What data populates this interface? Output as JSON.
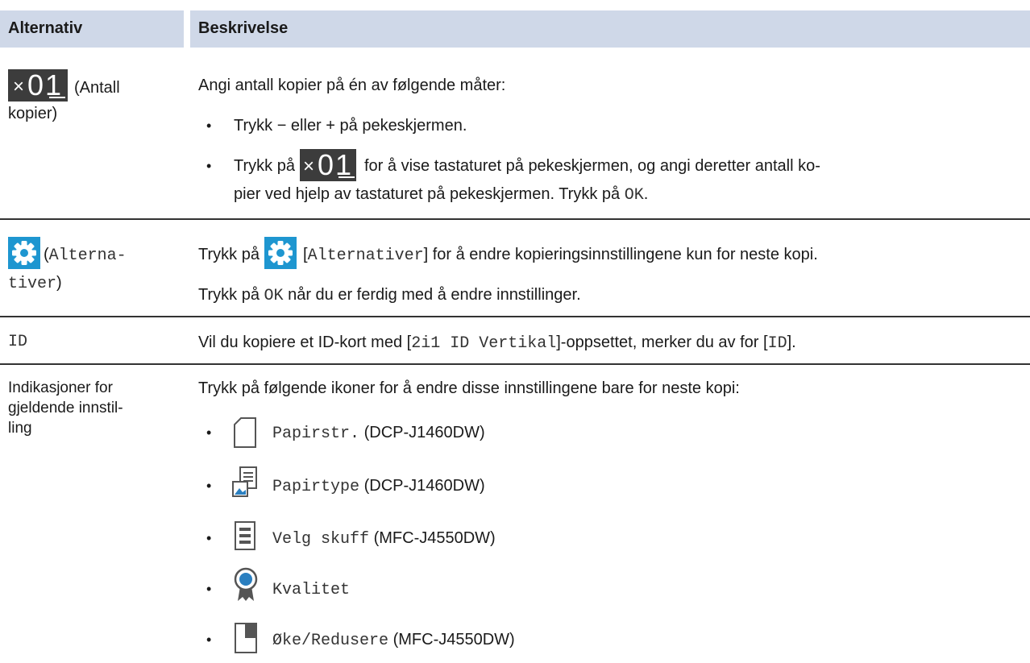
{
  "header": {
    "col1": "Alternativ",
    "col2": "Beskrivelse"
  },
  "row1": {
    "icon_x": "×",
    "icon_num": "01",
    "name1": "(Antall",
    "name2": "kopier)",
    "intro": "Angi antall kopier på én av følgende måter:",
    "b1": "Trykk − eller + på pekeskjermen.",
    "b2_pre": "Trykk på",
    "b2_post": "for å vise tastaturet på pekeskjermen, og angi deretter antall ko-",
    "b2_line2_pre": "pier ved hjelp av tastaturet på pekeskjermen. Trykk på",
    "b2_ok": "OK",
    "b2_end": "."
  },
  "row2": {
    "name1_paren": "(",
    "name1": "Alterna-",
    "name2": "tiver",
    "name2_paren": ")",
    "l1_pre": "Trykk på",
    "l1_bracket_open": "[",
    "l1_mono": "Alternativer",
    "l1_post": "] for å endre kopieringsinnstillingene kun for neste kopi.",
    "l2_pre": "Trykk på",
    "l2_ok": "OK",
    "l2_post": "når du er ferdig med å endre innstillinger."
  },
  "row3": {
    "name": "ID",
    "pre": "Vil du kopiere et ID-kort med [",
    "mono1": "2i1 ID Vertikal",
    "mid": "]-oppsettet, merker du av for [",
    "mono2": "ID",
    "end": "]."
  },
  "row4": {
    "name1": "Indikasjoner for",
    "name2": "gjeldende innstil-",
    "name3": "ling",
    "intro": "Trykk på følgende ikoner for å endre disse innstillingene bare for neste kopi:",
    "items": [
      {
        "mono": "Papirstr.",
        "note": "(DCP-J1460DW)",
        "icon": "paper-size-icon"
      },
      {
        "mono": "Papirtype",
        "note": "(DCP-J1460DW)",
        "icon": "paper-type-icon"
      },
      {
        "mono": "Velg skuff",
        "note": "(MFC-J4550DW)",
        "icon": "tray-select-icon"
      },
      {
        "mono": "Kvalitet",
        "note": "",
        "icon": "quality-icon"
      },
      {
        "mono": "Øke/Redusere",
        "note": "(MFC-J4550DW)",
        "icon": "enlarge-reduce-icon"
      }
    ]
  },
  "bullet": "•",
  "colors": {
    "header_bg": "#cfd8e8",
    "gear_bg": "#1e96d0",
    "counter_bg": "#3c3c3c",
    "icon_blue": "#2a7fc0"
  }
}
